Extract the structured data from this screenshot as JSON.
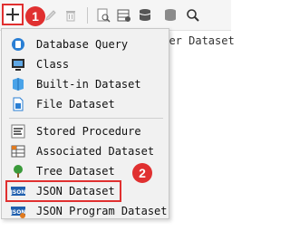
{
  "background_text": "rver Dataset",
  "menu": {
    "items": [
      {
        "label": "Database Query",
        "icon": "database-query-icon"
      },
      {
        "label": "Class",
        "icon": "class-monitor-icon"
      },
      {
        "label": "Built-in Dataset",
        "icon": "builtin-dataset-icon"
      },
      {
        "label": "File Dataset",
        "icon": "file-dataset-icon"
      },
      {
        "label": "Stored Procedure",
        "icon": "stored-procedure-icon"
      },
      {
        "label": "Associated Dataset",
        "icon": "associated-dataset-icon"
      },
      {
        "label": "Tree Dataset",
        "icon": "tree-dataset-icon"
      },
      {
        "label": "JSON Dataset",
        "icon": "json-icon"
      },
      {
        "label": "JSON Program Dataset",
        "icon": "json-program-icon"
      }
    ]
  },
  "annotations": {
    "step1": "1",
    "step2": "2"
  },
  "colors": {
    "highlight": "#e03030",
    "accent_blue": "#2a7fd4"
  }
}
